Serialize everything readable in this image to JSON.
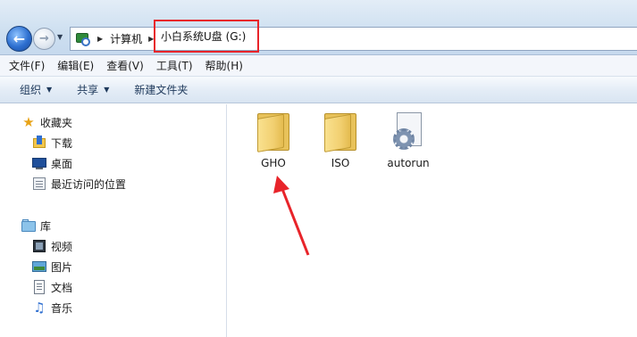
{
  "address_bar": {
    "breadcrumb": [
      "计算机",
      "小白系统U盘 (G:)"
    ]
  },
  "menu": [
    "文件(F)",
    "编辑(E)",
    "查看(V)",
    "工具(T)",
    "帮助(H)"
  ],
  "commands": {
    "organize": "组织",
    "share": "共享",
    "new_folder": "新建文件夹"
  },
  "navigation": {
    "favorites": {
      "label": "收藏夹",
      "items": [
        "下载",
        "桌面",
        "最近访问的位置"
      ]
    },
    "libraries": {
      "label": "库",
      "items": [
        "视频",
        "图片",
        "文档",
        "音乐"
      ]
    }
  },
  "files": [
    {
      "name": "GHO",
      "type": "folder"
    },
    {
      "name": "ISO",
      "type": "folder"
    },
    {
      "name": "autorun",
      "type": "setup-information"
    }
  ],
  "annotations": {
    "highlight_color": "#e8242a",
    "arrow_color": "#e8242a"
  }
}
